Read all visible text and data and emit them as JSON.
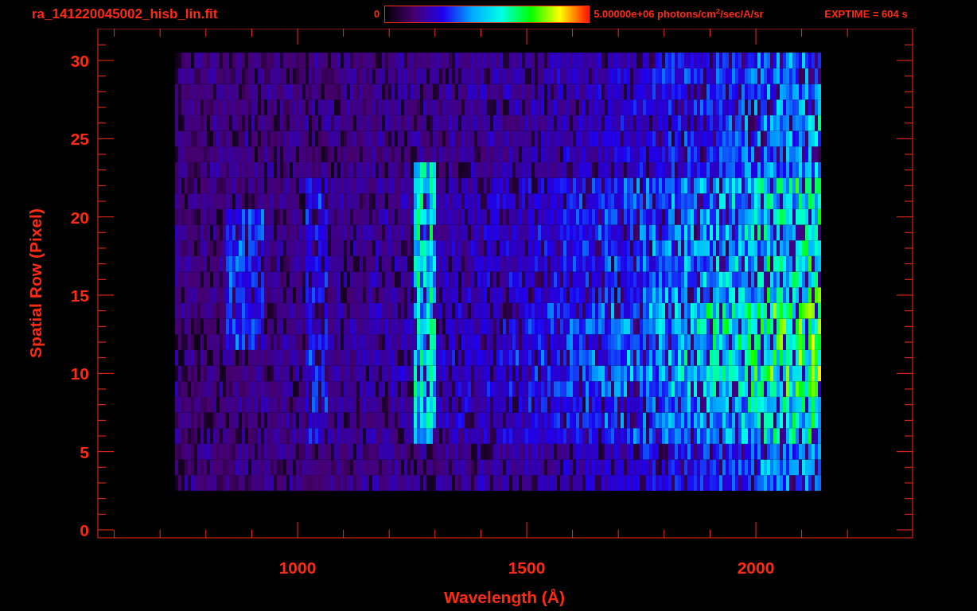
{
  "title": "ra_141220045002_hisb_lin.fit",
  "colorbar": {
    "min_label": "0",
    "max_label": "5.00000e+06 photons/cm$^{2}$/sec/A/sr"
  },
  "exptime": "EXPTIME = 604 s",
  "plot": {
    "x_axis": {
      "label": "Wavelength (Å)",
      "tick_labels": [
        "1000",
        "1500",
        "2000"
      ]
    },
    "y_axis": {
      "label": "Spatial Row (Pixel)",
      "tick_labels": [
        "30",
        "25",
        "20",
        "15",
        "10",
        "5",
        "0"
      ]
    }
  }
}
